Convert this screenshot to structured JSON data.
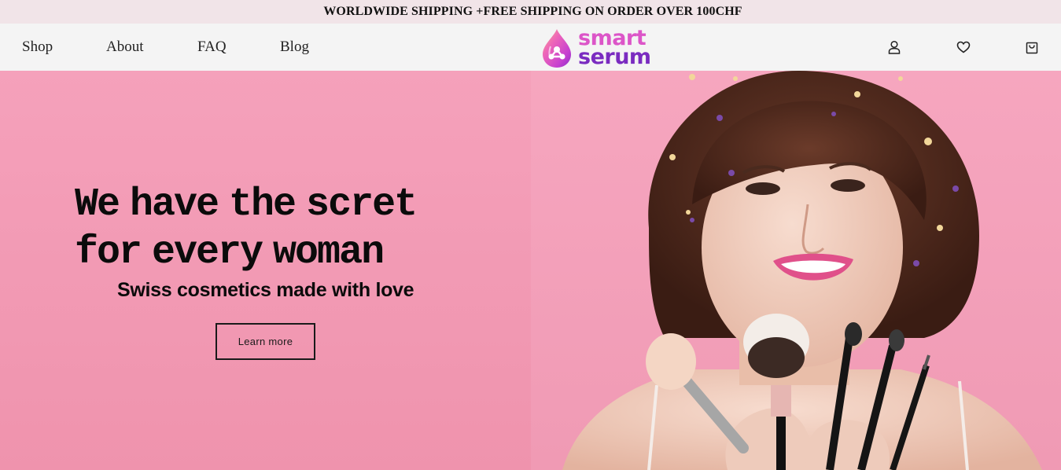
{
  "announcement": {
    "text": "WORLDWIDE SHIPPING +FREE SHIPPING ON ORDER OVER 100CHF"
  },
  "nav": {
    "items": [
      {
        "label": "Shop"
      },
      {
        "label": "About"
      },
      {
        "label": "FAQ"
      },
      {
        "label": "Blog"
      }
    ]
  },
  "logo": {
    "line1": "smart",
    "line2": "serum"
  },
  "header_icons": [
    "account-icon",
    "heart-icon",
    "cart-icon"
  ],
  "hero": {
    "title": "We have the scret\nfor every woman",
    "subtitle": "Swiss cosmetics made with love",
    "cta_label": "Learn more"
  },
  "colors": {
    "announcement_bg": "#f1e4e8",
    "header_bg": "#f4f4f4",
    "hero_bg": "#f4a0b9",
    "logo_pink": "#dc55c8",
    "logo_purple": "#7a2bc0"
  }
}
